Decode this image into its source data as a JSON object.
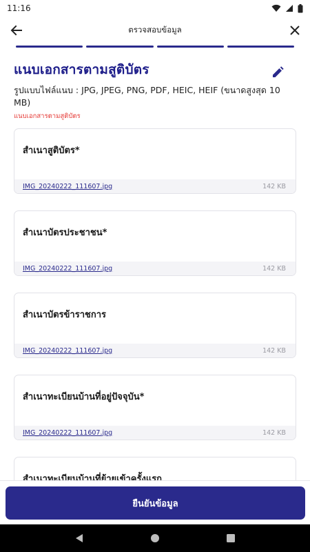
{
  "status": {
    "time": "11:16"
  },
  "header": {
    "title": "ตรวจสอบข้อมูล",
    "back_icon": "arrow-left-icon",
    "close_icon": "close-icon"
  },
  "stepper": {
    "total_steps": 4,
    "completed_steps": 4
  },
  "section": {
    "title": "แนบเอกสารตามสูติบัตร",
    "description": "รูปแบบไฟล์แนบ : JPG, JPEG, PNG, PDF, HEIC, HEIF (ขนาดสูงสุด 10 MB)",
    "error": "แนบเอกสารตามสูติบัตร",
    "edit_icon": "pencil-icon"
  },
  "documents": [
    {
      "title": "สำเนาสูติบัตร*",
      "file_name": "IMG_20240222_111607.jpg",
      "file_size": "142 KB"
    },
    {
      "title": "สำเนาบัตรประชาชน*",
      "file_name": "IMG_20240222_111607.jpg",
      "file_size": "142 KB"
    },
    {
      "title": "สำเนาบัตรข้าราชการ",
      "file_name": "IMG_20240222_111607.jpg",
      "file_size": "142 KB"
    },
    {
      "title": "สำเนาทะเบียนบ้านที่อยู่ปัจจุบัน*",
      "file_name": "IMG_20240222_111607.jpg",
      "file_size": "142 KB"
    },
    {
      "title": "สำเนาทะเบียนบ้านที่ย้ายเข้าครั้งแรก"
    }
  ],
  "footer": {
    "confirm_label": "ยืนยันข้อมูล"
  },
  "colors": {
    "primary": "#2a2a8c",
    "error": "#e53935"
  }
}
